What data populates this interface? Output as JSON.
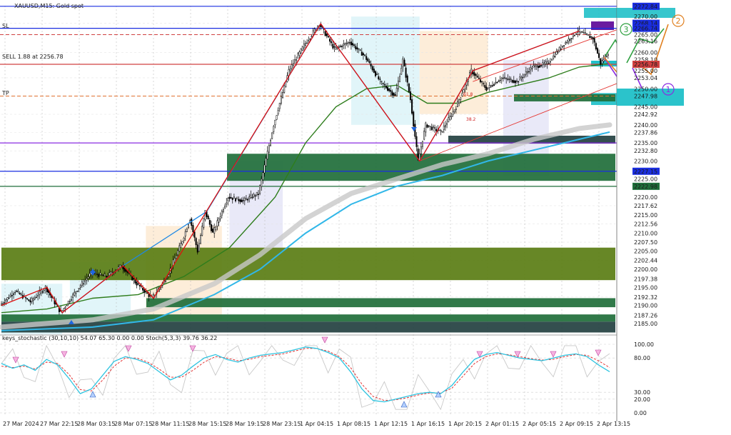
{
  "window": {
    "title": "XAUUSD,M15: Gold spot",
    "indicator_title": "keys_stochastic (30,10,10) 54.07 65.30 0.00 0.00 Stoch(5,3,3) 39.76 36.22"
  },
  "annotations": {
    "sl": "SL",
    "sell": "SELL 1.88 at 2256.78",
    "tp": "TP",
    "wave_1": "1",
    "wave_2": "2",
    "wave_3": "3",
    "fib_a": "61.8",
    "fib_b": "38.2"
  },
  "colors": {
    "bg": "#ffffff",
    "bull": "#000000",
    "bear": "#000000",
    "ma_fast": "#2e7d1c",
    "ma_slow": "#31b7e8",
    "ma_grey": "#c8c8c8",
    "zigzag_red": "#e01010",
    "zigzag_blue": "#1e88e5",
    "zone_green_dark": "#1f6e3a",
    "zone_olive": "#5a7d14",
    "zone_slate": "#234040",
    "zone_cyan": "#20c0c8",
    "level_blue": "#1a2ee0",
    "level_purple": "#8a2be2",
    "level_red": "#d04040",
    "stoch_main": "#2ec4e0",
    "stoch_signal": "#e02020",
    "stoch_keys": "#c8c8c8"
  },
  "chart_data": [
    {
      "type": "candlestick",
      "symbol": "XAUUSD",
      "timeframe": "M15",
      "x_labels": [
        "27 Mar 2024",
        "27 Mar 22:15",
        "28 Mar 03:15",
        "28 Mar 07:15",
        "28 Mar 11:15",
        "28 Mar 15:15",
        "28 Mar 19:15",
        "28 Mar 23:15",
        "1 Apr 04:15",
        "1 Apr 08:15",
        "1 Apr 12:15",
        "1 Apr 16:15",
        "1 Apr 20:15",
        "2 Apr 01:15",
        "2 Apr 05:15",
        "2 Apr 09:15",
        "2 Apr 13:15"
      ],
      "ylim": [
        2182.0,
        2273.0
      ],
      "y_ticks": [
        {
          "value": 2272.84,
          "label": "2272.84",
          "highlight": "#1a2ee0"
        },
        {
          "value": 2270.0,
          "label": "2270.00"
        },
        {
          "value": 2268.14,
          "label": "2268.14",
          "highlight": "#1a2ee0"
        },
        {
          "value": 2266.74,
          "label": "2266.74",
          "highlight": "#1a2ee0"
        },
        {
          "value": 2265.0,
          "label": "2265.00"
        },
        {
          "value": 2263.16,
          "label": "2263.16"
        },
        {
          "value": 2260.0,
          "label": "2260.00"
        },
        {
          "value": 2258.1,
          "label": "2258.10"
        },
        {
          "value": 2256.78,
          "label": "2256.78",
          "highlight": "#d04040"
        },
        {
          "value": 2255.0,
          "label": "2255.00"
        },
        {
          "value": 2253.04,
          "label": "2253.04"
        },
        {
          "value": 2250.0,
          "label": "2250.00"
        },
        {
          "value": 2247.98,
          "label": "2247.98"
        },
        {
          "value": 2245.0,
          "label": "2245.00"
        },
        {
          "value": 2242.92,
          "label": "2242.92"
        },
        {
          "value": 2240.0,
          "label": "2240.00"
        },
        {
          "value": 2237.86,
          "label": "2237.86"
        },
        {
          "value": 2235.0,
          "label": "2235.00"
        },
        {
          "value": 2232.8,
          "label": "2232.80"
        },
        {
          "value": 2230.0,
          "label": "2230.00"
        },
        {
          "value": 2227.15,
          "label": "2227.15",
          "highlight": "#1a2ee0"
        },
        {
          "value": 2225.0,
          "label": "2225.00"
        },
        {
          "value": 2222.98,
          "label": "2222.98",
          "highlight": "#1f6e3a"
        },
        {
          "value": 2220.0,
          "label": "2220.00"
        },
        {
          "value": 2217.62,
          "label": "2217.62"
        },
        {
          "value": 2215.0,
          "label": "2215.00"
        },
        {
          "value": 2212.56,
          "label": "2212.56"
        },
        {
          "value": 2210.0,
          "label": "2210.00"
        },
        {
          "value": 2207.5,
          "label": "2207.50"
        },
        {
          "value": 2205.0,
          "label": "2205.00"
        },
        {
          "value": 2202.44,
          "label": "2202.44"
        },
        {
          "value": 2200.0,
          "label": "2200.00"
        },
        {
          "value": 2197.38,
          "label": "2197.38"
        },
        {
          "value": 2195.0,
          "label": "2195.00"
        },
        {
          "value": 2192.32,
          "label": "2192.32"
        },
        {
          "value": 2190.0,
          "label": "2190.00"
        },
        {
          "value": 2187.26,
          "label": "2187.26"
        },
        {
          "value": 2185.0,
          "label": "2185.00"
        }
      ],
      "price_path": [
        [
          0,
          2190
        ],
        [
          2,
          2194
        ],
        [
          4,
          2191
        ],
        [
          6,
          2195
        ],
        [
          8,
          2188
        ],
        [
          10,
          2194
        ],
        [
          12,
          2199
        ],
        [
          14,
          2198
        ],
        [
          16,
          2201
        ],
        [
          18,
          2196
        ],
        [
          20,
          2192
        ],
        [
          22,
          2198
        ],
        [
          24,
          2208
        ],
        [
          25,
          2214
        ],
        [
          26,
          2205
        ],
        [
          27,
          2216
        ],
        [
          28,
          2210
        ],
        [
          30,
          2220
        ],
        [
          32,
          2219
        ],
        [
          34,
          2221
        ],
        [
          36,
          2240
        ],
        [
          38,
          2255
        ],
        [
          40,
          2262
        ],
        [
          42,
          2268
        ],
        [
          44,
          2261
        ],
        [
          46,
          2263
        ],
        [
          48,
          2259
        ],
        [
          50,
          2252
        ],
        [
          52,
          2248
        ],
        [
          53,
          2258
        ],
        [
          54,
          2247
        ],
        [
          55,
          2230
        ],
        [
          56,
          2240
        ],
        [
          58,
          2238
        ],
        [
          60,
          2245
        ],
        [
          62,
          2255
        ],
        [
          64,
          2250
        ],
        [
          66,
          2253
        ],
        [
          68,
          2252
        ],
        [
          70,
          2256
        ],
        [
          72,
          2257
        ],
        [
          74,
          2262
        ],
        [
          76,
          2266
        ],
        [
          78,
          2264
        ],
        [
          79,
          2257
        ],
        [
          80,
          2260
        ]
      ],
      "ma_fast_path": [
        [
          0,
          2188
        ],
        [
          6,
          2189
        ],
        [
          12,
          2192
        ],
        [
          18,
          2193
        ],
        [
          24,
          2198
        ],
        [
          30,
          2206
        ],
        [
          36,
          2220
        ],
        [
          40,
          2235
        ],
        [
          44,
          2245
        ],
        [
          48,
          2250
        ],
        [
          52,
          2251
        ],
        [
          56,
          2246
        ],
        [
          60,
          2246
        ],
        [
          64,
          2249
        ],
        [
          68,
          2251
        ],
        [
          72,
          2253
        ],
        [
          76,
          2256
        ],
        [
          80,
          2257
        ]
      ],
      "ma_slow_path": [
        [
          0,
          2183
        ],
        [
          12,
          2184
        ],
        [
          20,
          2186
        ],
        [
          28,
          2193
        ],
        [
          34,
          2200
        ],
        [
          40,
          2210
        ],
        [
          46,
          2218
        ],
        [
          52,
          2223
        ],
        [
          58,
          2226
        ],
        [
          64,
          2230
        ],
        [
          70,
          2233
        ],
        [
          76,
          2236
        ],
        [
          80,
          2238
        ]
      ],
      "ma_grey_path": [
        [
          0,
          2184
        ],
        [
          12,
          2186
        ],
        [
          20,
          2189
        ],
        [
          28,
          2196
        ],
        [
          34,
          2204
        ],
        [
          40,
          2214
        ],
        [
          46,
          2221
        ],
        [
          52,
          2225
        ],
        [
          58,
          2229
        ],
        [
          64,
          2232
        ],
        [
          70,
          2236
        ],
        [
          76,
          2239
        ],
        [
          80,
          2240
        ]
      ],
      "zigzag_red": [
        [
          0,
          2190
        ],
        [
          6,
          2195
        ],
        [
          8,
          2188
        ],
        [
          16,
          2201
        ],
        [
          20,
          2192
        ],
        [
          42,
          2268
        ],
        [
          55,
          2230
        ],
        [
          62,
          2255
        ],
        [
          76,
          2266
        ]
      ],
      "zigzag_blue": [
        [
          8,
          2188
        ],
        [
          16,
          2201
        ],
        [
          27,
          2216
        ],
        [
          42,
          2268
        ],
        [
          55,
          2230
        ],
        [
          62,
          2255
        ],
        [
          76,
          2266
        ]
      ],
      "levels": [
        {
          "value": 2272.84,
          "color": "#1a2ee0",
          "style": "solid"
        },
        {
          "value": 2266.74,
          "color": "#1a2ee0",
          "style": "solid"
        },
        {
          "value": 2265.0,
          "color": "#d04040",
          "style": "dash"
        },
        {
          "value": 2256.78,
          "color": "#d04040",
          "style": "solid"
        },
        {
          "value": 2247.98,
          "color": "#e07030",
          "style": "dash"
        },
        {
          "value": 2235.0,
          "color": "#8a2be2",
          "style": "solid"
        },
        {
          "value": 2227.15,
          "color": "#1a2ee0",
          "style": "solid"
        },
        {
          "value": 2222.98,
          "color": "#1f6e3a",
          "style": "solid"
        }
      ],
      "zones": [
        {
          "from": 2224.5,
          "to": 2232.0,
          "color": "#1f6e3a"
        },
        {
          "from": 2197.0,
          "to": 2206.0,
          "color": "#5a7d14"
        },
        {
          "from": 2189.5,
          "to": 2192.0,
          "color": "#1f6e3a"
        },
        {
          "from": 2185.5,
          "to": 2187.5,
          "color": "#1f6e3a"
        },
        {
          "from": 2182.5,
          "to": 2185.5,
          "color": "#234040"
        },
        {
          "from": 2234.8,
          "to": 2237.0,
          "color": "#234040"
        },
        {
          "from": 2245.5,
          "to": 2248.8,
          "color": "#20c0c8"
        },
        {
          "from": 2246.5,
          "to": 2248.5,
          "color": "#1f6e3a"
        }
      ]
    },
    {
      "type": "line",
      "title": "keys_stochastic (30,10,10) 54.07 65.30 0.00 0.00 Stoch(5,3,3) 39.76 36.22",
      "ylim": [
        0,
        100
      ],
      "y_ticks": [
        100,
        80,
        30,
        20,
        0
      ],
      "y_tick_labels": [
        "100.00",
        "80.00",
        "30.00",
        "20.00",
        "0.00"
      ],
      "series": [
        {
          "values": [
            72,
            65,
            70,
            62,
            78,
            70,
            50,
            28,
            35,
            55,
            75,
            82,
            78,
            72,
            60,
            48,
            55,
            68,
            80,
            85,
            78,
            74,
            80,
            84,
            86,
            88,
            92,
            96,
            94,
            88,
            80,
            60,
            35,
            18,
            16,
            20,
            24,
            28,
            30,
            28,
            40,
            60,
            78,
            85,
            88,
            84,
            80,
            78,
            76,
            80,
            84,
            86,
            82,
            70,
            60
          ]
        },
        {
          "values": [
            68,
            66,
            68,
            64,
            74,
            72,
            56,
            34,
            32,
            48,
            68,
            80,
            80,
            74,
            64,
            52,
            52,
            62,
            74,
            82,
            80,
            76,
            78,
            82,
            84,
            86,
            90,
            94,
            94,
            90,
            82,
            66,
            42,
            24,
            18,
            19,
            22,
            26,
            29,
            29,
            36,
            54,
            72,
            82,
            86,
            85,
            82,
            79,
            77,
            78,
            82,
            85,
            84,
            76,
            66
          ]
        }
      ]
    }
  ]
}
